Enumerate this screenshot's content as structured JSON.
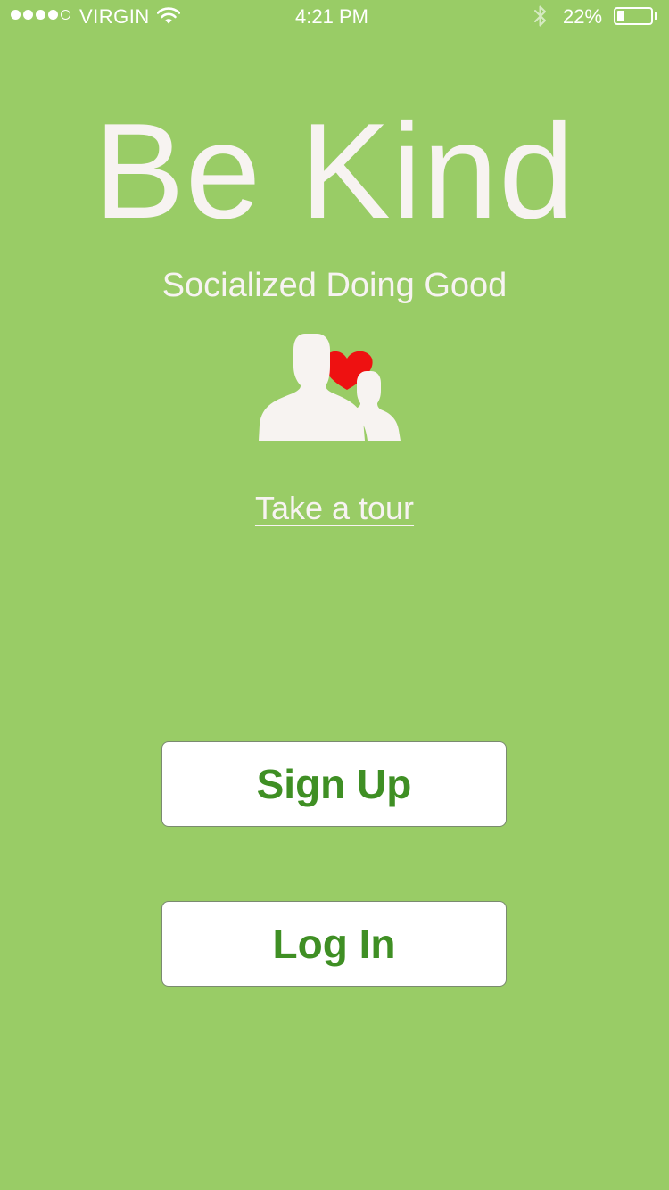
{
  "status_bar": {
    "carrier": "VIRGIN",
    "signal_bars_filled": 4,
    "signal_bars_total": 5,
    "time": "4:21 PM",
    "battery_percent_label": "22%",
    "battery_level": 0.22,
    "icons": [
      "wifi-icon",
      "bluetooth-icon",
      "battery-icon"
    ]
  },
  "app": {
    "title": "Be Kind",
    "tagline": "Socialized Doing Good",
    "logo_icon": "people-heart-icon",
    "tour_link": "Take a tour"
  },
  "buttons": {
    "sign_up": "Sign Up",
    "log_in": "Log In"
  },
  "colors": {
    "background": "#99cc66",
    "text_light": "#f7f3f1",
    "button_text": "#3f8f24",
    "heart": "#ee1111"
  }
}
